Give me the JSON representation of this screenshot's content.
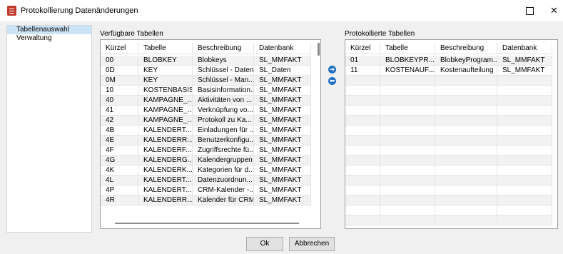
{
  "window": {
    "title": "Protokollierung Datenänderungen",
    "maximize_icon": "maximize-icon",
    "close_glyph": "✕"
  },
  "nav": {
    "items": [
      "Tabellenauswahl",
      "Verwaltung"
    ],
    "selected": 0
  },
  "available": {
    "label": "Verfügbare Tabellen",
    "columns": [
      "Kürzel",
      "Tabelle",
      "Beschreibung",
      "Datenbank"
    ],
    "rows": [
      [
        "00",
        "BLOBKEY",
        "Blobkeys",
        "SL_MMFAKT"
      ],
      [
        "0D",
        "KEY",
        "Schlüssel - Daten",
        "SL_Daten"
      ],
      [
        "0M",
        "KEY",
        "Schlüssel - Man...",
        "SL_MMFAKT"
      ],
      [
        "10",
        "KOSTENBASIS",
        "Basisinformation...",
        "SL_MMFAKT"
      ],
      [
        "40",
        "KAMPAGNE_...",
        "Aktivitäten von ...",
        "SL_MMFAKT"
      ],
      [
        "41",
        "KAMPAGNE_...",
        "Verknüpfung vo...",
        "SL_MMFAKT"
      ],
      [
        "42",
        "KAMPAGNE_...",
        "Protokoll zu Ka...",
        "SL_MMFAKT"
      ],
      [
        "4B",
        "KALENDERT...",
        "Einladungen für ...",
        "SL_MMFAKT"
      ],
      [
        "4E",
        "KALENDERR...",
        "Benutzerkonfigu...",
        "SL_MMFAKT"
      ],
      [
        "4F",
        "KALENDERF...",
        "Zugriffsrechte fü...",
        "SL_MMFAKT"
      ],
      [
        "4G",
        "KALENDERG...",
        "Kalendergruppen",
        "SL_MMFAKT"
      ],
      [
        "4K",
        "KALENDERK...",
        "Kategorien für d...",
        "SL_MMFAKT"
      ],
      [
        "4L",
        "KALENDERT...",
        "Datenzuordnun...",
        "SL_MMFAKT"
      ],
      [
        "4P",
        "KALENDERT...",
        "CRM-Kalender -...",
        "SL_MMFAKT"
      ],
      [
        "4R",
        "KALENDERR...",
        "Kalender für CRM",
        "SL_MMFAKT"
      ]
    ]
  },
  "logged": {
    "label": "Protokollierte Tabellen",
    "columns": [
      "Kürzel",
      "Tabelle",
      "Beschreibung",
      "Datenbank"
    ],
    "rows": [
      [
        "01",
        "BLOBKEYPR...",
        "BlobkeyProgram...",
        "SL_MMFAKT"
      ],
      [
        "11",
        "KOSTENAUF...",
        "Kostenaufteilung",
        "SL_MMFAKT"
      ]
    ]
  },
  "transfer": {
    "add_icon": "arrow-right-icon",
    "remove_icon": "arrow-left-icon",
    "add_glyph": "➔",
    "remove_glyph": "⬅"
  },
  "buttons": {
    "ok": "Ok",
    "cancel": "Abbrechen"
  },
  "colors": {
    "selection": "#cce4f7",
    "accent": "#1f6fc6",
    "app_icon": "#c0392b"
  }
}
